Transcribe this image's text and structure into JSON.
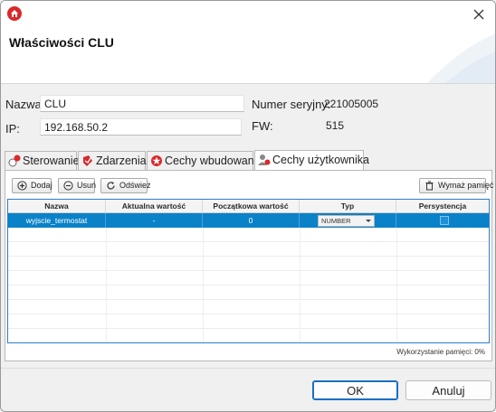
{
  "window": {
    "title": "Właściwości CLU",
    "accent": "#0a82c8",
    "app_icon": "home-icon"
  },
  "fields": {
    "name_label": "Nazwa:",
    "name_value": "CLU",
    "serial_label": "Numer seryjny:",
    "serial_value": "221005005",
    "ip_label": "IP:",
    "ip_value": "192.168.50.2",
    "fw_label": "FW:",
    "fw_value": "515"
  },
  "tabs": [
    {
      "label": "Sterowanie",
      "icon": "control-icon"
    },
    {
      "label": "Zdarzenia",
      "icon": "events-icon"
    },
    {
      "label": "Cechy wbudowane",
      "icon": "star-icon"
    },
    {
      "label": "Cechy użytkownika",
      "icon": "user-features-icon",
      "active": true
    }
  ],
  "toolbar": {
    "add_label": "Dodaj",
    "remove_label": "Usuń",
    "refresh_label": "Odśwież",
    "clear_memory_label": "Wymaż pamięć"
  },
  "table": {
    "headers": [
      "Nazwa",
      "Aktualna wartość",
      "Początkowa wartość",
      "Typ",
      "Persystencja"
    ],
    "rows": [
      {
        "name": "wyjscie_termostat",
        "current": "-",
        "initial": "0",
        "type": "NUMBER",
        "persistence": false
      }
    ]
  },
  "memory_usage": "Wykorzystanie pamięci:  0%",
  "buttons": {
    "ok": "OK",
    "cancel": "Anuluj"
  }
}
